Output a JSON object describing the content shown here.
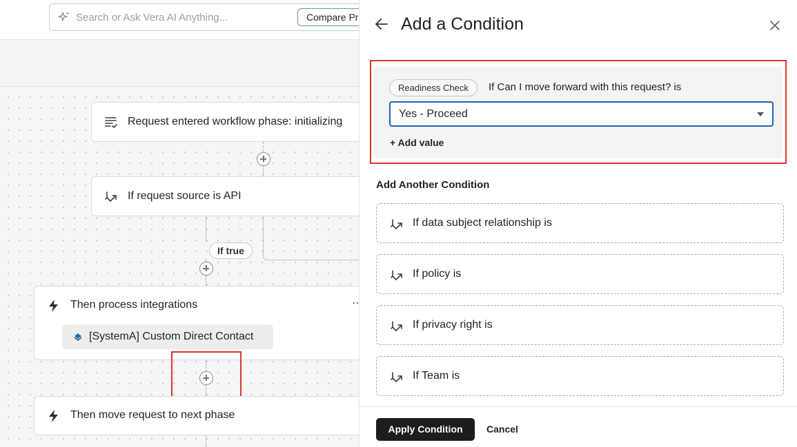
{
  "search": {
    "placeholder": "Search or Ask Vera AI Anything...",
    "compare_label": "Compare Pr"
  },
  "workflow": {
    "nodes": [
      {
        "label": "Request entered workflow phase: initializing",
        "icon": "list-check-icon"
      },
      {
        "label": "If request source is API",
        "icon": "branch-icon"
      },
      {
        "label": "Then process integrations",
        "icon": "lightning-icon"
      },
      {
        "label": "Then move request to next phase",
        "icon": "lightning-icon"
      }
    ],
    "if_true_label": "If true",
    "integration_chip": "[SystemA] Custom Direct Contact"
  },
  "drawer": {
    "title": "Add a Condition",
    "condition": {
      "variable_chip": "Readiness Check",
      "question": "If Can I move forward with this request? is",
      "selected_value": "Yes - Proceed",
      "add_value_label": "+ Add value"
    },
    "another_heading": "Add Another Condition",
    "options": [
      {
        "label": "If data subject relationship is"
      },
      {
        "label": "If policy is"
      },
      {
        "label": "If privacy right is"
      },
      {
        "label": "If Team is"
      }
    ],
    "apply_label": "Apply Condition",
    "cancel_label": "Cancel"
  },
  "colors": {
    "highlight": "#e0332a",
    "select_border": "#1f63b8",
    "primary_button": "#1c1e1c"
  }
}
